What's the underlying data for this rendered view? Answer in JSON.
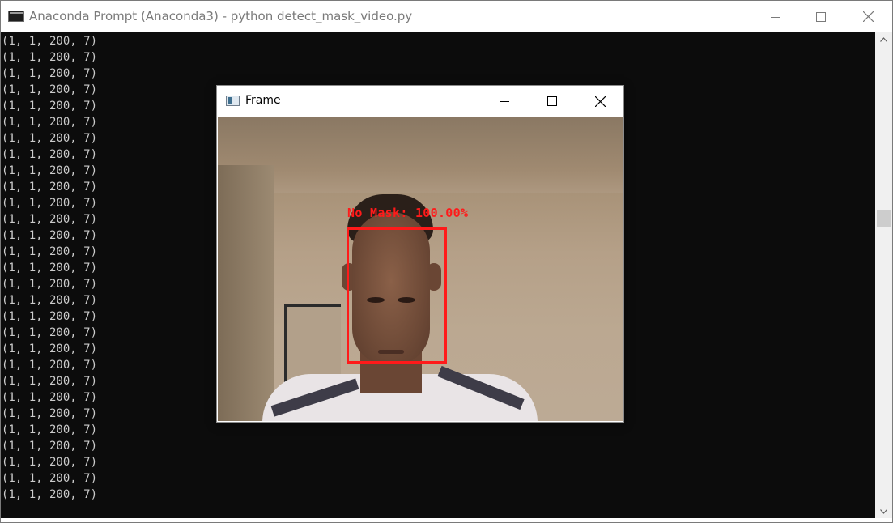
{
  "console": {
    "title": "Anaconda Prompt (Anaconda3) - python  detect_mask_video.py",
    "icon": "console-icon",
    "lines": [
      "(1, 1, 200, 7)",
      "(1, 1, 200, 7)",
      "(1, 1, 200, 7)",
      "(1, 1, 200, 7)",
      "(1, 1, 200, 7)",
      "(1, 1, 200, 7)",
      "(1, 1, 200, 7)",
      "(1, 1, 200, 7)",
      "(1, 1, 200, 7)",
      "(1, 1, 200, 7)",
      "(1, 1, 200, 7)",
      "(1, 1, 200, 7)",
      "(1, 1, 200, 7)",
      "(1, 1, 200, 7)",
      "(1, 1, 200, 7)",
      "(1, 1, 200, 7)",
      "(1, 1, 200, 7)",
      "(1, 1, 200, 7)",
      "(1, 1, 200, 7)",
      "(1, 1, 200, 7)",
      "(1, 1, 200, 7)",
      "(1, 1, 200, 7)",
      "(1, 1, 200, 7)",
      "(1, 1, 200, 7)",
      "(1, 1, 200, 7)",
      "(1, 1, 200, 7)",
      "(1, 1, 200, 7)",
      "(1, 1, 200, 7)",
      "(1, 1, 200, 7)"
    ]
  },
  "frame": {
    "title": "Frame",
    "icon": "opencv-window-icon",
    "detection_label": "No Mask: 100.00%",
    "detection_color": "#ff1a1a"
  },
  "colors": {
    "console_bg": "#0c0c0c",
    "console_text": "#cccccc"
  }
}
